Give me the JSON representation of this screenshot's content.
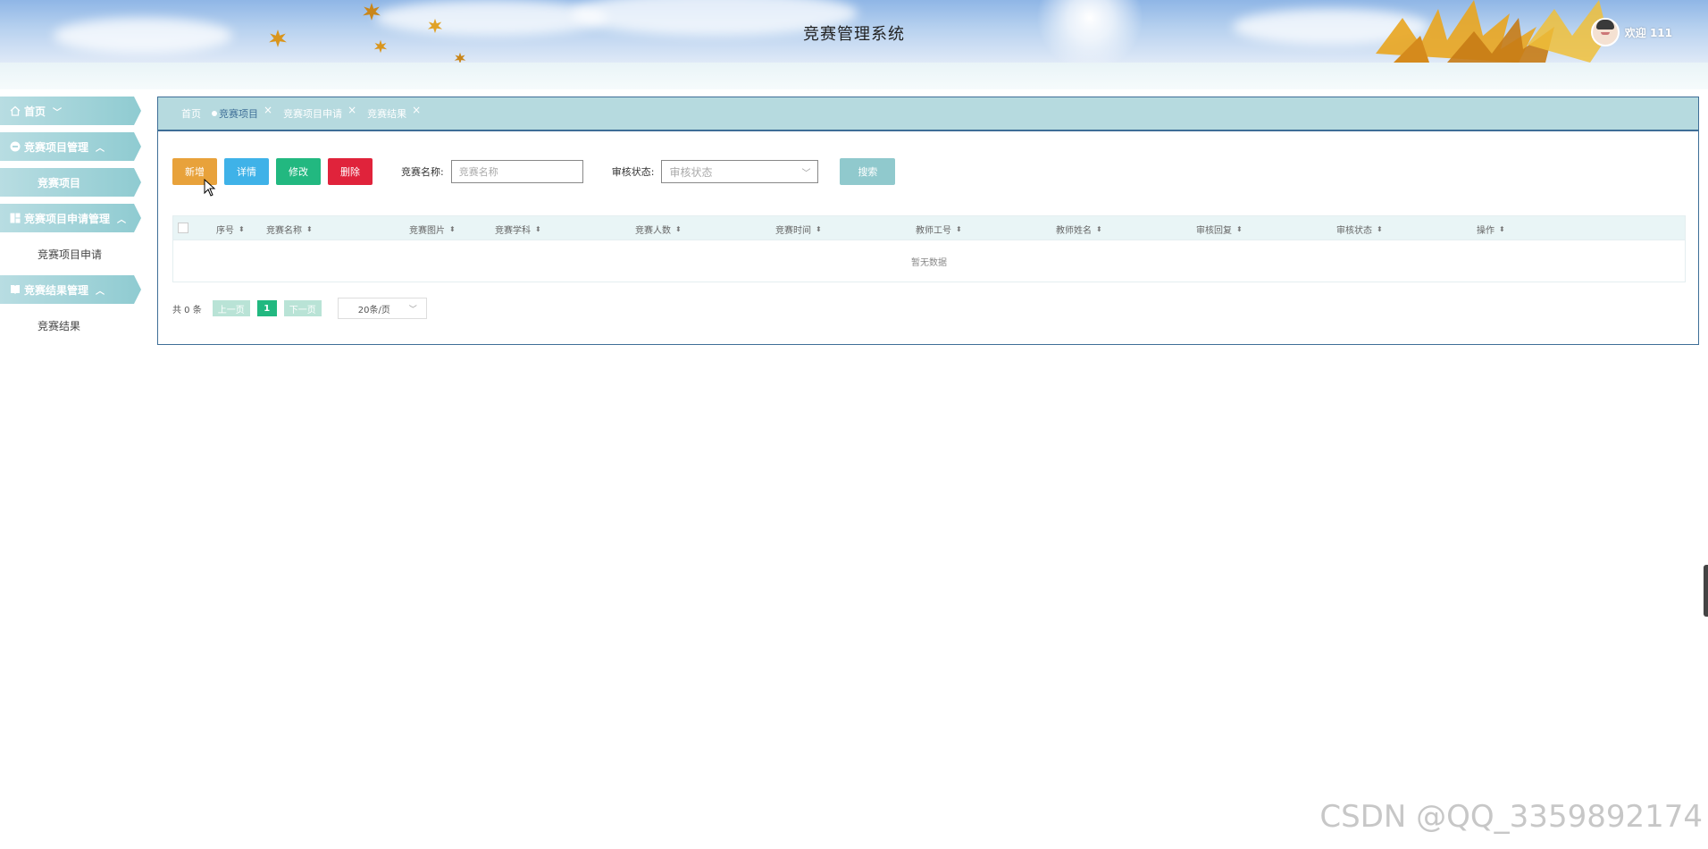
{
  "header": {
    "title": "竞赛管理系统",
    "welcome": "欢迎 111"
  },
  "sidebar": {
    "groups": [
      {
        "label": "首页",
        "icon": "home-icon",
        "chevron": "﹀",
        "children": []
      },
      {
        "label": "竞赛项目管理",
        "icon": "circle-minus-icon",
        "chevron": "︿",
        "children": [
          {
            "label": "竞赛项目",
            "active": true
          }
        ]
      },
      {
        "label": "竞赛项目申请管理",
        "icon": "grid-icon",
        "chevron": "︿",
        "children": [
          {
            "label": "竞赛项目申请",
            "active": false
          }
        ]
      },
      {
        "label": "竞赛结果管理",
        "icon": "book-icon",
        "chevron": "︿",
        "children": [
          {
            "label": "竞赛结果",
            "active": false
          }
        ]
      }
    ]
  },
  "tabs": [
    {
      "label": "首页",
      "active": false,
      "closable": false
    },
    {
      "label": "竞赛项目",
      "active": true,
      "closable": true
    },
    {
      "label": "竞赛项目申请",
      "active": false,
      "closable": true
    },
    {
      "label": "竞赛结果",
      "active": false,
      "closable": true
    }
  ],
  "toolbar": {
    "add_label": "新增",
    "detail_label": "详情",
    "edit_label": "修改",
    "delete_label": "删除",
    "name_label": "竞赛名称:",
    "name_placeholder": "竞赛名称",
    "status_label": "审核状态:",
    "status_placeholder": "审核状态",
    "search_label": "搜索"
  },
  "table": {
    "columns": [
      "序号",
      "竞赛名称",
      "竞赛图片",
      "竞赛学科",
      "竞赛人数",
      "竞赛时间",
      "教师工号",
      "教师姓名",
      "审核回复",
      "审核状态",
      "操作"
    ],
    "empty_text": "暂无数据"
  },
  "pager": {
    "total": "共 0 条",
    "prev": "上一页",
    "page": "1",
    "next": "下一页",
    "page_size": "20条/页"
  },
  "watermark": "CSDN @QQ_3359892174",
  "colors": {
    "accent_teal": "#8fcbd1",
    "border_blue": "#3e6e97",
    "add": "#e8a23b",
    "detail": "#3fb2e8",
    "edit": "#22b880",
    "delete": "#e0233b"
  }
}
